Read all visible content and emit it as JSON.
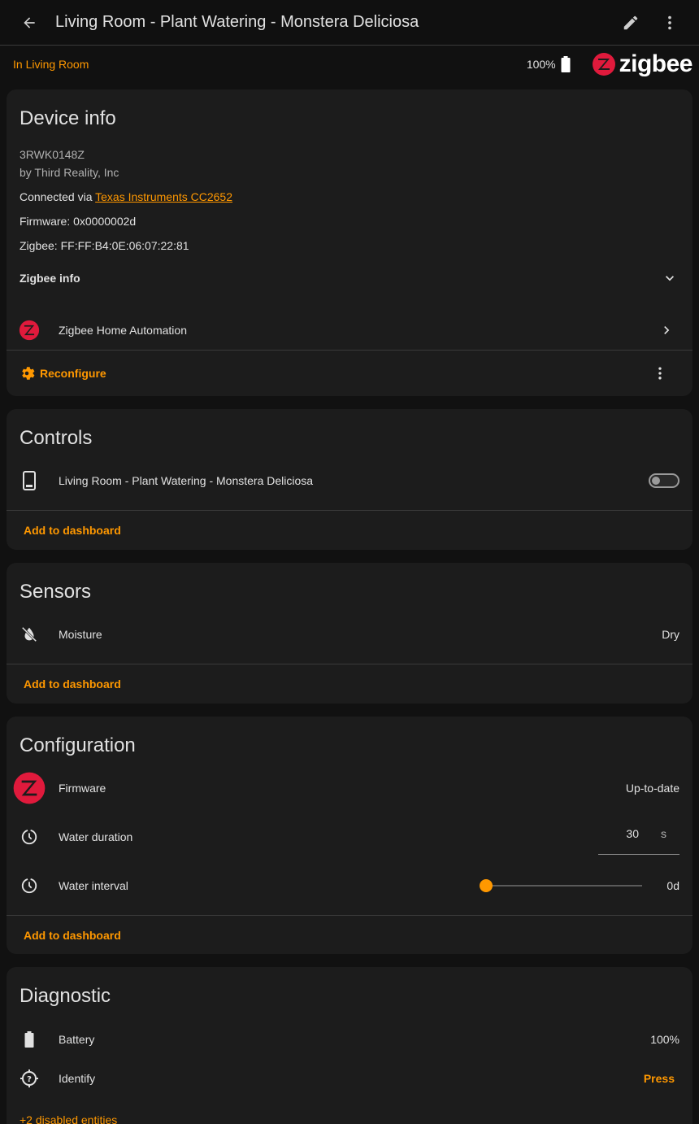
{
  "header": {
    "title": "Living Room - Plant Watering - Monstera Deliciosa",
    "back_icon": "arrow-left-icon",
    "edit_icon": "pencil-icon",
    "menu_icon": "dots-vertical-icon"
  },
  "subheader": {
    "area": "In Living Room",
    "battery": "100%",
    "integration_logo_text": "zigbee"
  },
  "device_info": {
    "title": "Device info",
    "model": "3RWK0148Z",
    "manufacturer": "by Third Reality, Inc",
    "connected_prefix": "Connected via ",
    "connected_link": "Texas Instruments CC2652",
    "firmware": "Firmware: 0x0000002d",
    "zigbee_addr": "Zigbee: FF:FF:B4:0E:06:07:22:81",
    "zigbee_info_label": "Zigbee info",
    "integration_label": "Zigbee Home Automation",
    "reconfigure_label": "Reconfigure"
  },
  "controls": {
    "title": "Controls",
    "entity_label": "Living Room - Plant Watering - Monstera Deliciosa",
    "add_label": "Add to dashboard"
  },
  "sensors": {
    "title": "Sensors",
    "moisture_label": "Moisture",
    "moisture_value": "Dry",
    "add_label": "Add to dashboard"
  },
  "configuration": {
    "title": "Configuration",
    "firmware_label": "Firmware",
    "firmware_value": "Up-to-date",
    "duration_label": "Water duration",
    "duration_value": "30",
    "duration_unit": "s",
    "interval_label": "Water interval",
    "interval_value": "0d",
    "interval_slider_fraction": 0,
    "add_label": "Add to dashboard"
  },
  "diagnostic": {
    "title": "Diagnostic",
    "battery_label": "Battery",
    "battery_value": "100%",
    "identify_label": "Identify",
    "identify_action": "Press",
    "disabled_entities": "+2 disabled entities"
  },
  "colors": {
    "accent": "#ff9800",
    "zigbee_red": "#e01a3c",
    "card_bg": "#1c1c1c"
  }
}
